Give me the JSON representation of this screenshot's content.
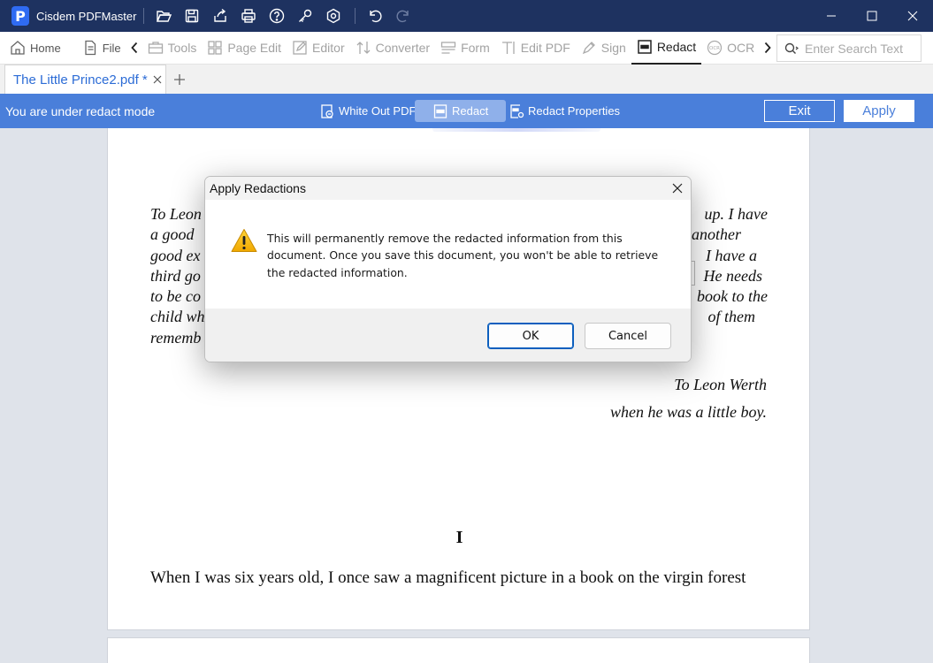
{
  "app": {
    "title": "Cisdem PDFMaster",
    "logo_letter": "P",
    "title_icons": [
      "folder-open-icon",
      "save-icon",
      "share-icon",
      "print-icon",
      "help-icon",
      "key-icon",
      "settings-icon",
      "undo-icon",
      "redo-icon"
    ],
    "window_controls": [
      "minimize-icon",
      "maximize-icon",
      "close-icon"
    ]
  },
  "toolbar": {
    "home": "Home",
    "file": "File",
    "tools": "Tools",
    "page_edit": "Page Edit",
    "editor": "Editor",
    "converter": "Converter",
    "form": "Form",
    "edit_pdf": "Edit PDF",
    "sign": "Sign",
    "redact": "Redact",
    "ocr": "OCR",
    "search_placeholder": "Enter Search Text"
  },
  "tabs": [
    {
      "label": "The Little Prince2.pdf *",
      "active": true
    }
  ],
  "redact_bar": {
    "mode_text": "You are under redact mode",
    "white_out": "White Out PDF",
    "redact": "Redact",
    "properties": "Redact Properties",
    "exit": "Exit",
    "apply": "Apply"
  },
  "document": {
    "dedication_lines": [
      "To Leon",
      "a good",
      "good ex",
      "third go",
      "to be co",
      "child wh",
      "rememb"
    ],
    "dedication_right_lines": [
      "up. I have",
      "another",
      "I have a",
      "He needs",
      "book to the",
      "of them"
    ],
    "signature_line1": "To Leon Werth",
    "signature_line2": "when he was a little boy.",
    "chapter": "I",
    "body_line": "When I was six years old, I once saw a magnificent picture in a book on the virgin forest"
  },
  "dialog": {
    "title": "Apply Redactions",
    "message": "This will permanently remove the redacted information from this document. Once you save this document, you won't be able to retrieve the redacted information.",
    "ok": "OK",
    "cancel": "Cancel"
  }
}
